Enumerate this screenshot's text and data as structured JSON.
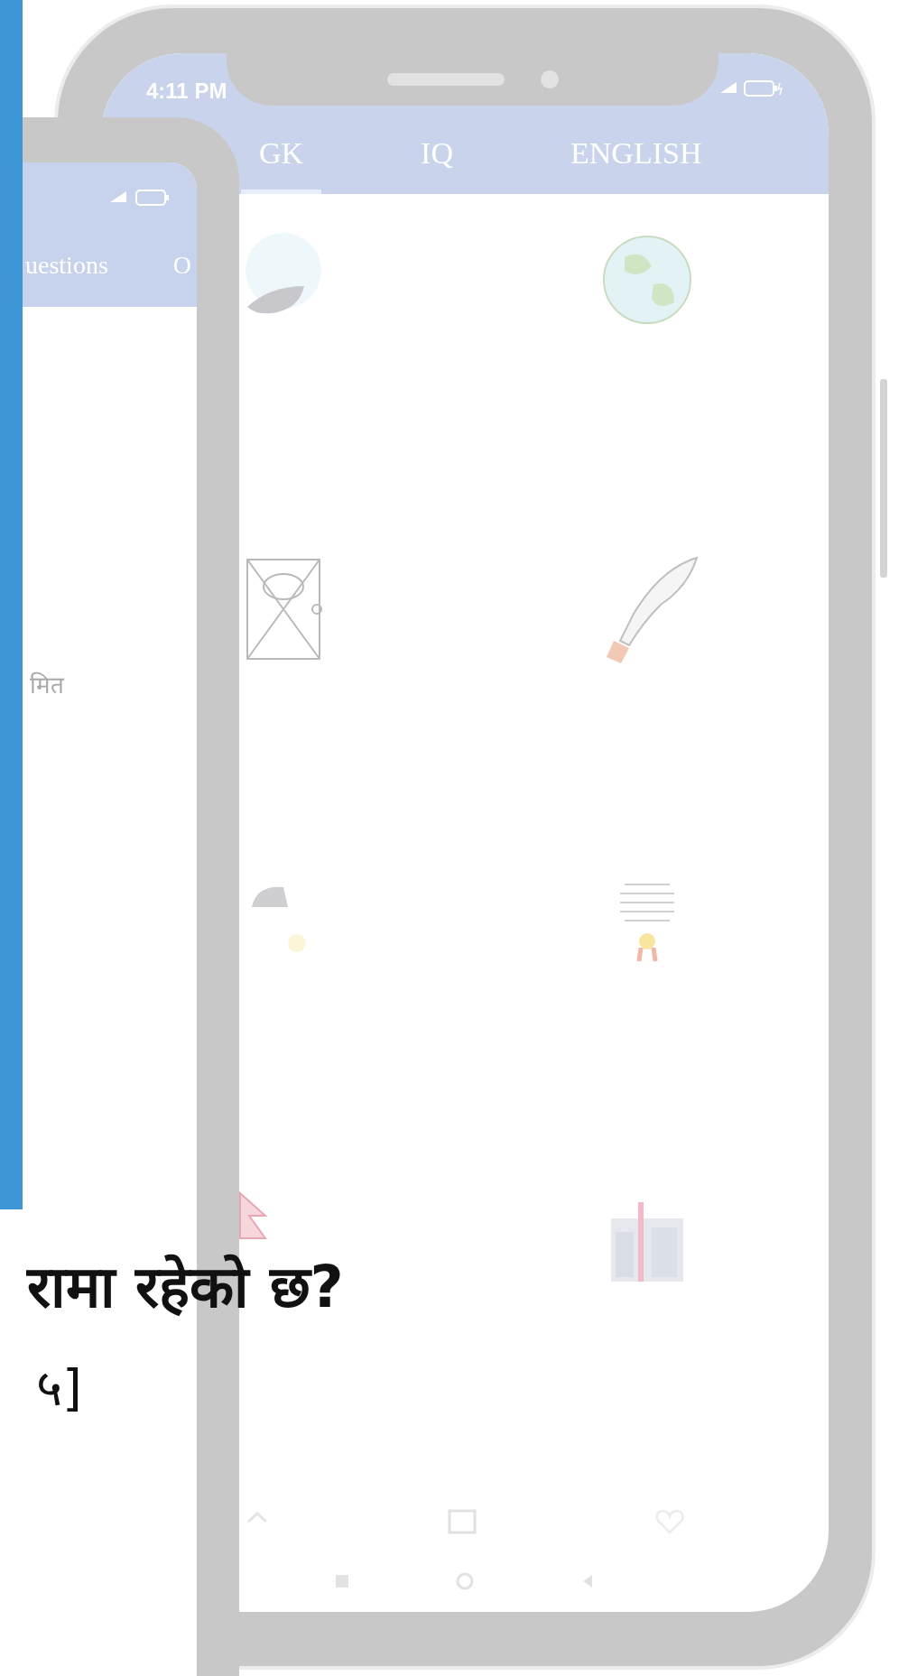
{
  "front_phone": {
    "status_bar": {
      "time": "4:11 PM"
    },
    "tabs": [
      {
        "label": "GK",
        "selected": true
      },
      {
        "label": "IQ",
        "selected": false
      },
      {
        "label": "ENGLISH",
        "selected": false
      }
    ]
  },
  "back_phone": {
    "tabs": [
      {
        "label": "uestions"
      },
      {
        "label": "O"
      }
    ],
    "label": "मित"
  },
  "overlay_text": {
    "question": "रामा रहेको छ?",
    "answer": "५]"
  }
}
